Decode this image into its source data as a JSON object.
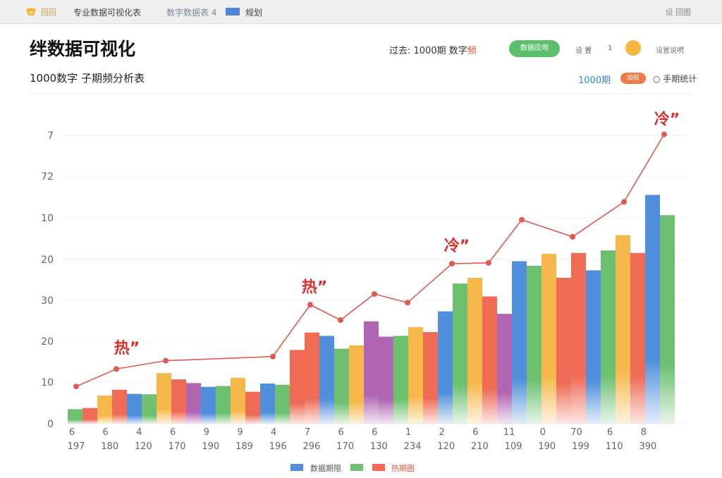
{
  "topbar": {
    "logo_text": "回回",
    "nav_items": [
      "专业数据可视化表",
      "数字数据表 4",
      "规划"
    ],
    "right_text": "设 回图"
  },
  "header": {
    "title": "绊数据可视化",
    "subtitle": "1000数字 子期频分析表",
    "period_label": "过去: 1000期",
    "period_accent_prefix": "数字",
    "period_accent": "频",
    "green_button": "数据应用",
    "setting_label": "设 置",
    "setting_value": "1",
    "setting_2": "设置说明",
    "chevron": "⌄",
    "blue_link": "1000期",
    "orange_pill": "加权",
    "right_link": "○ 手期统计"
  },
  "colors": {
    "blue": "#4f8fdc",
    "green": "#6cc070",
    "orange": "#f7b84b",
    "red": "#ef6b55",
    "purple": "#b066b3",
    "line": "#dc5b52",
    "annotation": "#d8302b"
  },
  "chart_data": {
    "type": "bar",
    "title": "",
    "xlabel": "",
    "ylabel": "",
    "y_ticks": [
      "0",
      "10",
      "20",
      "30",
      "20",
      "10",
      "72",
      "7"
    ],
    "x_digits": [
      "6",
      "6",
      "4",
      "6",
      "9",
      "9",
      "4",
      "7",
      "6",
      "6",
      "1",
      "2",
      "6",
      "11",
      "0",
      "70",
      "6",
      "8"
    ],
    "x_values": [
      "197",
      "180",
      "120",
      "170",
      "190",
      "189",
      "196",
      "296",
      "170",
      "130",
      "234",
      "120",
      "210",
      "109",
      "190",
      "199",
      "110",
      "390"
    ],
    "groups": [
      {
        "bars": [
          {
            "v": 3.5,
            "c": "green"
          },
          {
            "v": 3.8,
            "c": "red"
          }
        ]
      },
      {
        "bars": [
          {
            "v": 6.8,
            "c": "orange"
          },
          {
            "v": 8.2,
            "c": "red"
          }
        ]
      },
      {
        "bars": [
          {
            "v": 7.2,
            "c": "blue"
          },
          {
            "v": 7.1,
            "c": "green"
          }
        ]
      },
      {
        "bars": [
          {
            "v": 12.2,
            "c": "orange"
          },
          {
            "v": 10.7,
            "c": "red"
          }
        ]
      },
      {
        "bars": [
          {
            "v": 9.8,
            "c": "purple"
          },
          {
            "v": 8.9,
            "c": "blue"
          }
        ]
      },
      {
        "bars": [
          {
            "v": 9.1,
            "c": "green"
          },
          {
            "v": 11.1,
            "c": "orange"
          }
        ]
      },
      {
        "bars": [
          {
            "v": 7.7,
            "c": "red"
          },
          {
            "v": 9.7,
            "c": "blue"
          }
        ]
      },
      {
        "bars": [
          {
            "v": 9.4,
            "c": "green"
          },
          {
            "v": 17.8,
            "c": "red"
          }
        ]
      },
      {
        "bars": [
          {
            "v": 22.0,
            "c": "red"
          },
          {
            "v": 21.2,
            "c": "blue"
          }
        ]
      },
      {
        "bars": [
          {
            "v": 18.1,
            "c": "green"
          },
          {
            "v": 18.9,
            "c": "orange"
          }
        ]
      },
      {
        "bars": [
          {
            "v": 24.7,
            "c": "purple"
          },
          {
            "v": 21.0,
            "c": "purple"
          }
        ]
      },
      {
        "bars": [
          {
            "v": 21.2,
            "c": "green"
          },
          {
            "v": 23.3,
            "c": "orange"
          }
        ]
      },
      {
        "bars": [
          {
            "v": 22.1,
            "c": "red"
          },
          {
            "v": 27.1,
            "c": "blue"
          }
        ]
      },
      {
        "bars": [
          {
            "v": 33.8,
            "c": "green"
          },
          {
            "v": 35.2,
            "c": "orange"
          }
        ]
      },
      {
        "bars": [
          {
            "v": 30.7,
            "c": "red"
          },
          {
            "v": 26.5,
            "c": "purple"
          }
        ]
      },
      {
        "bars": [
          {
            "v": 39.2,
            "c": "blue"
          },
          {
            "v": 38.1,
            "c": "green"
          }
        ]
      },
      {
        "bars": [
          {
            "v": 41.0,
            "c": "orange"
          },
          {
            "v": 35.2,
            "c": "red"
          }
        ]
      },
      {
        "bars": [
          {
            "v": 41.2,
            "c": "red"
          },
          {
            "v": 37.0,
            "c": "blue"
          }
        ]
      },
      {
        "bars": [
          {
            "v": 41.8,
            "c": "green"
          },
          {
            "v": 45.5,
            "c": "orange"
          }
        ]
      },
      {
        "bars": [
          {
            "v": 41.2,
            "c": "red"
          },
          {
            "v": 55.2,
            "c": "blue"
          }
        ]
      },
      {
        "bars": [
          {
            "v": 50.3,
            "c": "green"
          }
        ]
      }
    ],
    "line_points": [
      {
        "x": 108,
        "v": 9.0
      },
      {
        "x": 165,
        "v": 13.2
      },
      {
        "x": 235,
        "v": 15.2
      },
      {
        "x": 387,
        "v": 16.2
      },
      {
        "x": 440,
        "v": 28.7
      },
      {
        "x": 483,
        "v": 25.0
      },
      {
        "x": 531,
        "v": 31.3
      },
      {
        "x": 578,
        "v": 29.2
      },
      {
        "x": 641,
        "v": 38.6
      },
      {
        "x": 693,
        "v": 38.8
      },
      {
        "x": 740,
        "v": 49.2
      },
      {
        "x": 812,
        "v": 45.1
      },
      {
        "x": 885,
        "v": 53.5
      },
      {
        "x": 942,
        "v": 69.8
      }
    ],
    "annotations": [
      {
        "text": "热”",
        "x": 180,
        "v": 17.0
      },
      {
        "text": "热”",
        "x": 446,
        "v": 31.7
      },
      {
        "text": "冷”",
        "x": 648,
        "v": 41.7
      },
      {
        "text": "冷”",
        "x": 946,
        "v": 72.2
      }
    ],
    "ylim": [
      0,
      75
    ],
    "legend": [
      {
        "label": "数据期限",
        "color": "blue"
      },
      {
        "label": "",
        "color": "green"
      },
      {
        "label": "热期图",
        "color": "red"
      }
    ]
  }
}
